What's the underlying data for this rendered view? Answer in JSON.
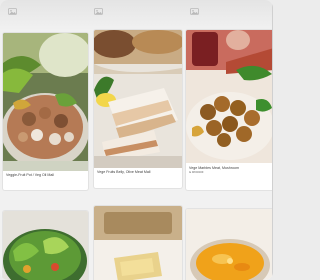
{
  "toolbar": {
    "left_icon": "photo-icon",
    "mid_icon": "photo-icon",
    "right_icon": "photo-icon"
  },
  "cards": [
    {
      "title": "Veggie-Fruit Pot / Veg Oil Mall",
      "subtitle": "",
      "image": "hot-pot-with-meatballs-and-vegetables"
    },
    {
      "title": "Vege Fruits Belly, Olive Meat Mall",
      "subtitle": "",
      "image": "sliced-pork-belly-with-lemon"
    },
    {
      "title": "Vege Marbles Meat, Mushroom",
      "subtitle": "& Broccoli",
      "image": "braised-meatballs-with-broccoli"
    },
    {
      "title": "",
      "subtitle": "",
      "image": "green-vegetable-salad-bowl"
    },
    {
      "title": "",
      "subtitle": "",
      "image": "toast-with-soup"
    },
    {
      "title": "",
      "subtitle": "",
      "image": "golden-soup-in-bowl"
    }
  ],
  "colors": {
    "background": "#f1f1f1",
    "card": "#ffffff",
    "title_text": "#3b3b3b"
  }
}
